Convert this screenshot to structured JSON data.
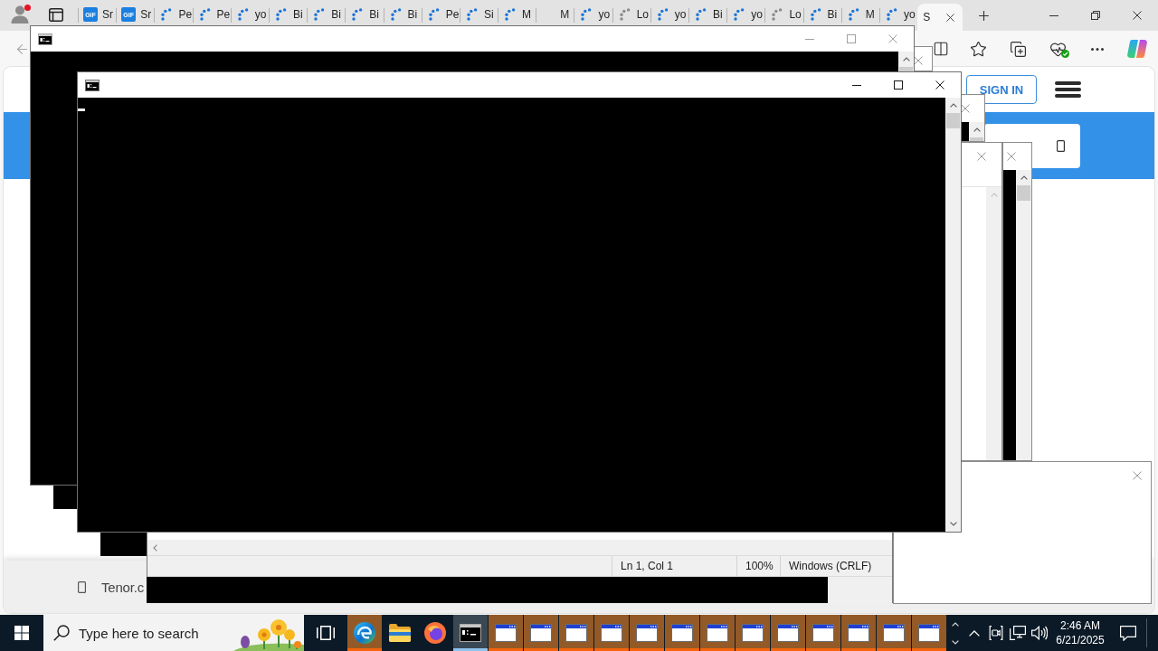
{
  "browser": {
    "tabs": [
      {
        "title": "Sr",
        "kind": "gif",
        "favicon_text": "GIF",
        "selected": false
      },
      {
        "title": "Sr",
        "kind": "gif",
        "favicon_text": "GIF",
        "selected": false
      },
      {
        "title": "Pe",
        "kind": "loading",
        "selected": false
      },
      {
        "title": "Pe",
        "kind": "loading",
        "selected": false
      },
      {
        "title": "yo",
        "kind": "loading",
        "selected": false
      },
      {
        "title": "Bi",
        "kind": "loading",
        "selected": false
      },
      {
        "title": "Bi",
        "kind": "loading",
        "selected": false
      },
      {
        "title": "Bi",
        "kind": "loading",
        "selected": false
      },
      {
        "title": "Bi",
        "kind": "loading",
        "selected": false
      },
      {
        "title": "Pe",
        "kind": "loading",
        "selected": false
      },
      {
        "title": "Si",
        "kind": "loading",
        "selected": false
      },
      {
        "title": "M",
        "kind": "loading",
        "selected": false
      },
      {
        "title": "M",
        "kind": "blank",
        "selected": false
      },
      {
        "title": "yo",
        "kind": "loading",
        "selected": false
      },
      {
        "title": "Lo",
        "kind": "stalled",
        "selected": false
      },
      {
        "title": "yo",
        "kind": "loading",
        "selected": false
      },
      {
        "title": "Bi",
        "kind": "loading",
        "selected": false
      },
      {
        "title": "yo",
        "kind": "loading",
        "selected": false
      },
      {
        "title": "Lo",
        "kind": "stalled",
        "selected": false
      },
      {
        "title": "Bi",
        "kind": "loading",
        "selected": false
      },
      {
        "title": "M",
        "kind": "loading",
        "selected": false
      },
      {
        "title": "yo",
        "kind": "loading",
        "selected": false
      },
      {
        "title": "S",
        "kind": "blank",
        "selected": true
      }
    ],
    "page": {
      "sign_in": "SIGN IN",
      "bottom_bar": "Tenor.c"
    }
  },
  "console_windows": [
    {
      "active": false,
      "cursor": false
    },
    {
      "active": true,
      "cursor": true
    }
  ],
  "notepad": {
    "status_bar": [
      {
        "text": "Ln 1, Col 1"
      },
      {
        "text": "100%"
      },
      {
        "text": "Windows (CRLF)"
      }
    ]
  },
  "taskbar": {
    "search": {
      "placeholder": "Type here to search"
    },
    "apps": [
      {
        "kind": "edge",
        "flashing": true,
        "active": false
      },
      {
        "kind": "explorer",
        "flashing": false,
        "active": false
      },
      {
        "kind": "firefox",
        "flashing": false,
        "active": false
      },
      {
        "kind": "console",
        "flashing": false,
        "active": true
      },
      {
        "kind": "window",
        "flashing": true,
        "active": false
      },
      {
        "kind": "window",
        "flashing": true,
        "active": false
      },
      {
        "kind": "window",
        "flashing": true,
        "active": false
      },
      {
        "kind": "window",
        "flashing": true,
        "active": false
      },
      {
        "kind": "window",
        "flashing": true,
        "active": false
      },
      {
        "kind": "window",
        "flashing": true,
        "active": false
      },
      {
        "kind": "window",
        "flashing": true,
        "active": false
      },
      {
        "kind": "window",
        "flashing": true,
        "active": false
      },
      {
        "kind": "window",
        "flashing": true,
        "active": false
      },
      {
        "kind": "window",
        "flashing": true,
        "active": false
      },
      {
        "kind": "window",
        "flashing": true,
        "active": false
      },
      {
        "kind": "window",
        "flashing": true,
        "active": false
      },
      {
        "kind": "window",
        "flashing": true,
        "active": false
      }
    ],
    "clock": {
      "time": "2:46 AM",
      "date": "6/21/2025"
    }
  }
}
